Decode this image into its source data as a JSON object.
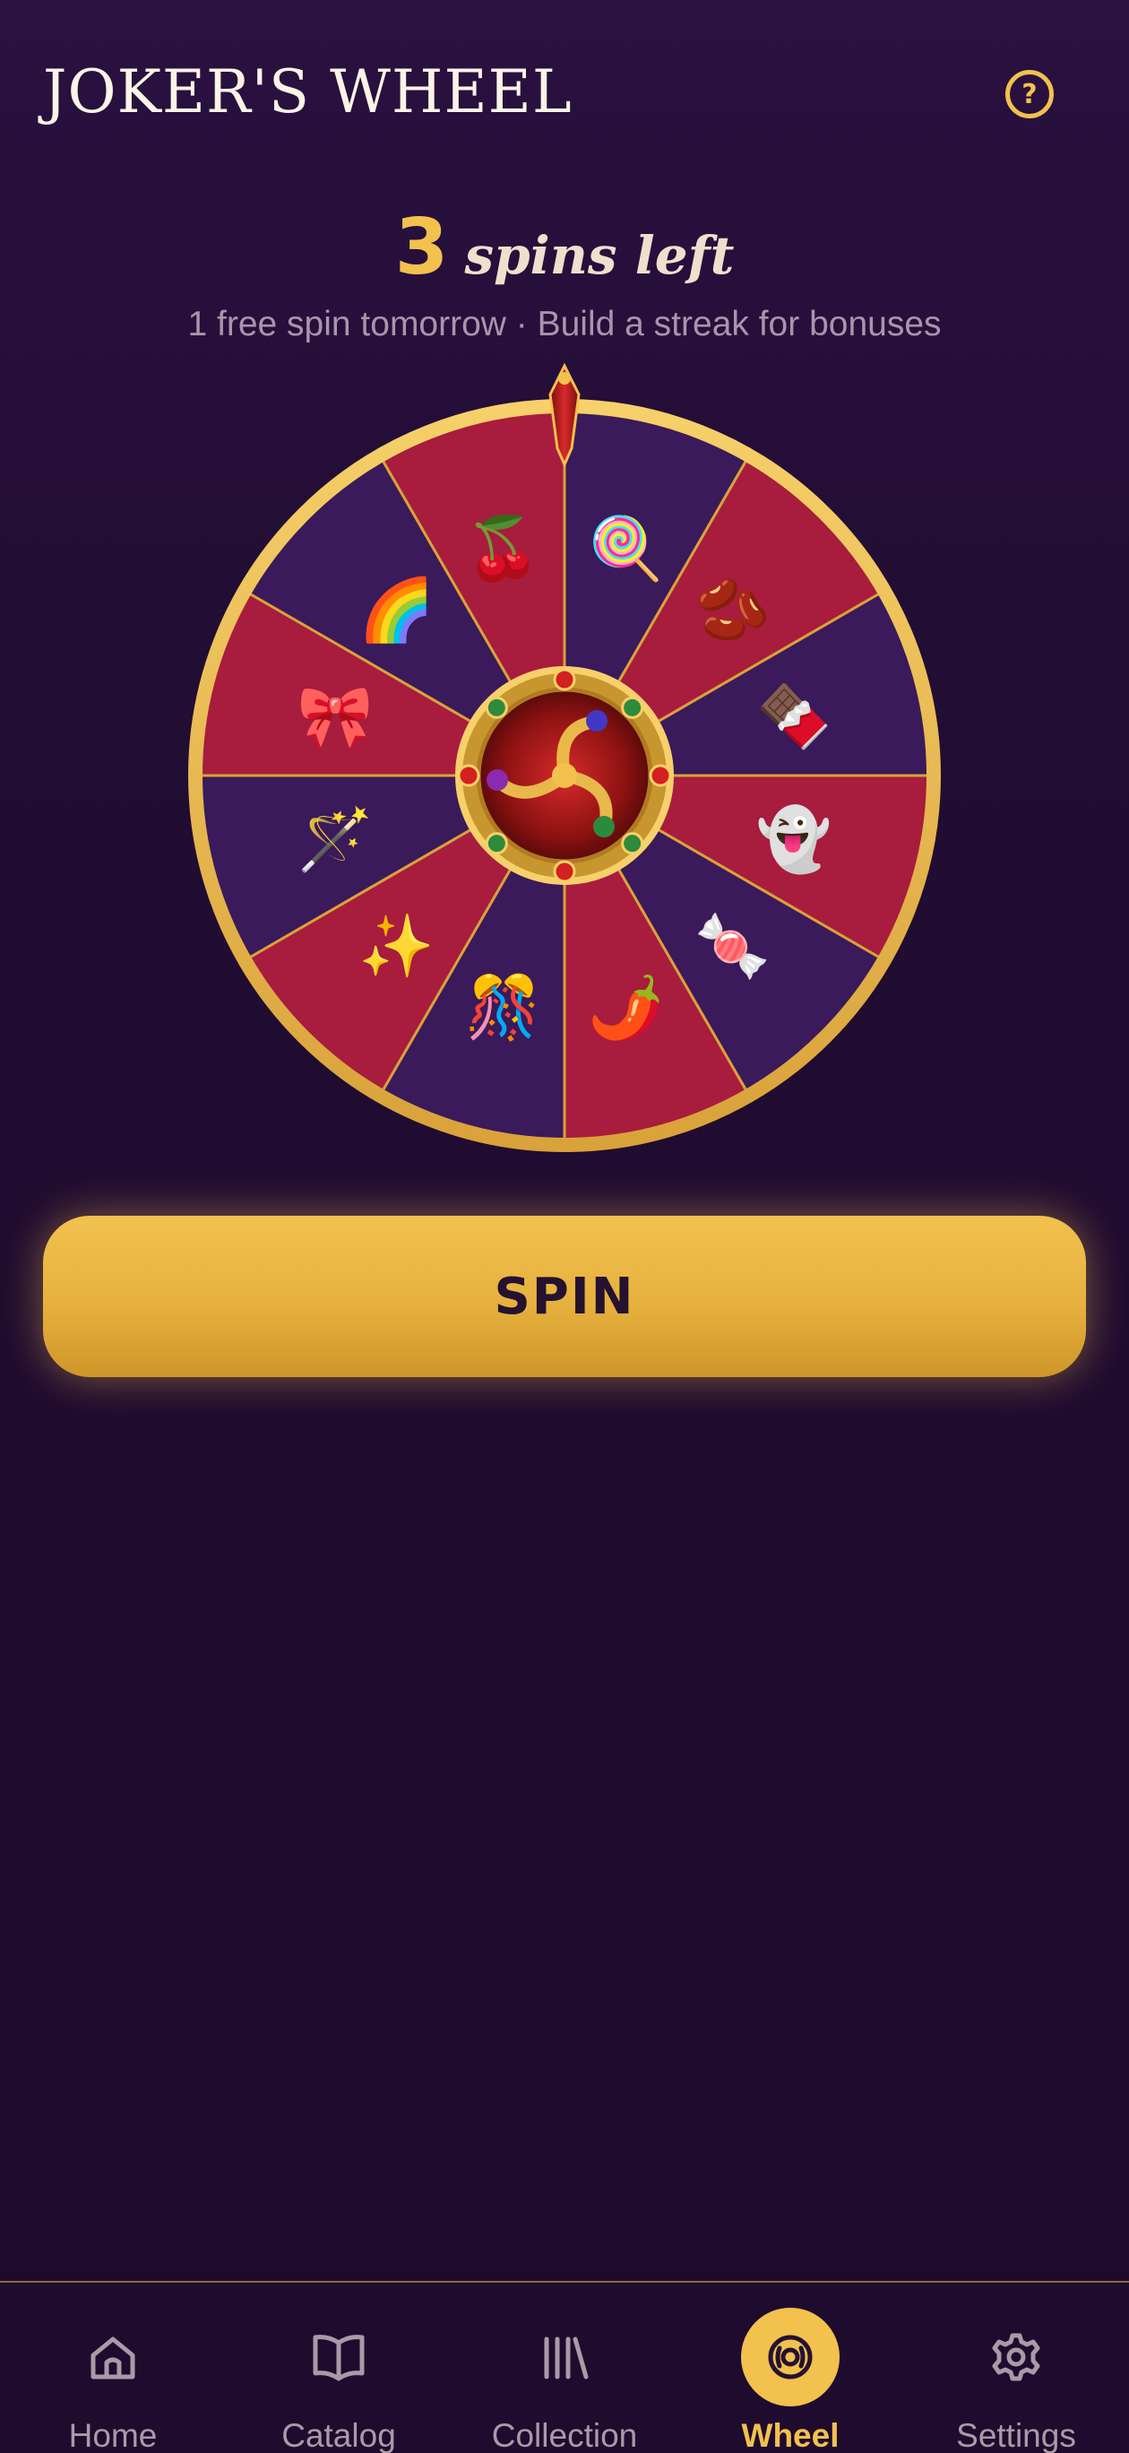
{
  "header": {
    "title": "JOKER'S WHEEL",
    "help_icon": "question-mark-icon"
  },
  "spins": {
    "count": "3",
    "label": "spins left",
    "subtitle": "1 free spin tomorrow · Build a streak for bonuses"
  },
  "wheel": {
    "segments": [
      {
        "emoji": "🍭",
        "color": "#3a1a5a"
      },
      {
        "emoji": "🫘",
        "color": "#a81c3e"
      },
      {
        "emoji": "🍫",
        "color": "#3a1a5a"
      },
      {
        "emoji": "👻",
        "color": "#a81c3e"
      },
      {
        "emoji": "🍬",
        "color": "#3a1a5a"
      },
      {
        "emoji": "🌶️",
        "color": "#a81c3e"
      },
      {
        "emoji": "🎊",
        "color": "#3a1a5a"
      },
      {
        "emoji": "✨",
        "color": "#a81c3e"
      },
      {
        "emoji": "🪄",
        "color": "#3a1a5a"
      },
      {
        "emoji": "🎀",
        "color": "#a81c3e"
      },
      {
        "emoji": "🌈",
        "color": "#3a1a5a"
      },
      {
        "emoji": "🍒",
        "color": "#a81c3e"
      }
    ],
    "rim_color": "#f2c14e",
    "hub_icon": "jester-emblem-icon",
    "pointer_icon": "pointer-icon"
  },
  "spin_button": {
    "label": "SPIN"
  },
  "nav": {
    "items": [
      {
        "label": "Home",
        "icon": "home-icon"
      },
      {
        "label": "Catalog",
        "icon": "book-icon"
      },
      {
        "label": "Collection",
        "icon": "library-icon"
      },
      {
        "label": "Wheel",
        "icon": "wheel-icon",
        "active": true
      },
      {
        "label": "Settings",
        "icon": "gear-icon"
      }
    ]
  },
  "colors": {
    "accent": "#f2c14e",
    "background": "#1f0b2e",
    "segment_red": "#a81c3e",
    "segment_purple": "#3a1a5a"
  }
}
